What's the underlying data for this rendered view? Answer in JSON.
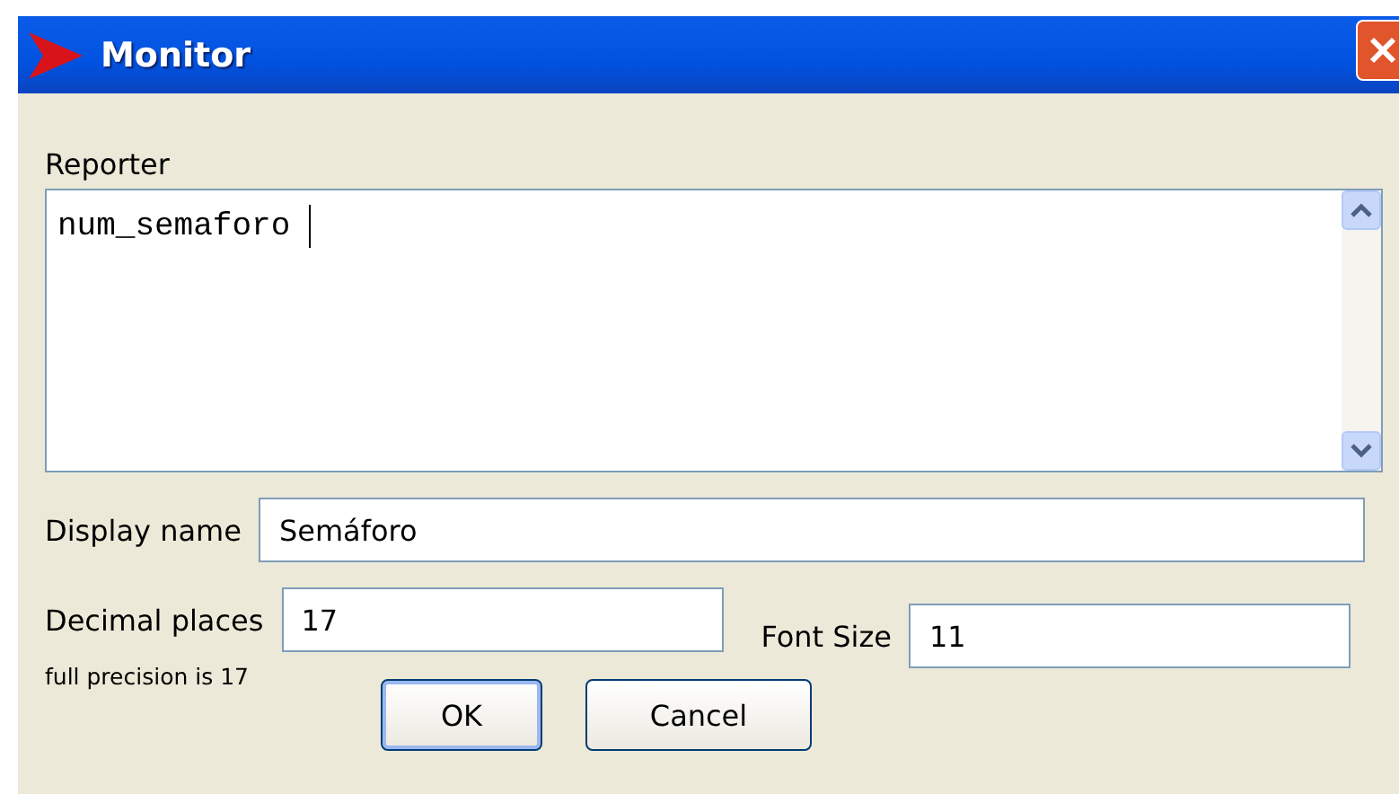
{
  "window": {
    "title": "Monitor"
  },
  "reporter": {
    "label": "Reporter",
    "value": "num_semaforo "
  },
  "display_name": {
    "label": "Display name",
    "value": "Semáforo"
  },
  "decimal_places": {
    "label": "Decimal places",
    "value": "17",
    "hint": "full precision is 17"
  },
  "font_size": {
    "label": "Font Size",
    "value": "11"
  },
  "buttons": [
    {
      "label": "OK",
      "default": true
    },
    {
      "label": "Cancel",
      "default": false
    }
  ]
}
